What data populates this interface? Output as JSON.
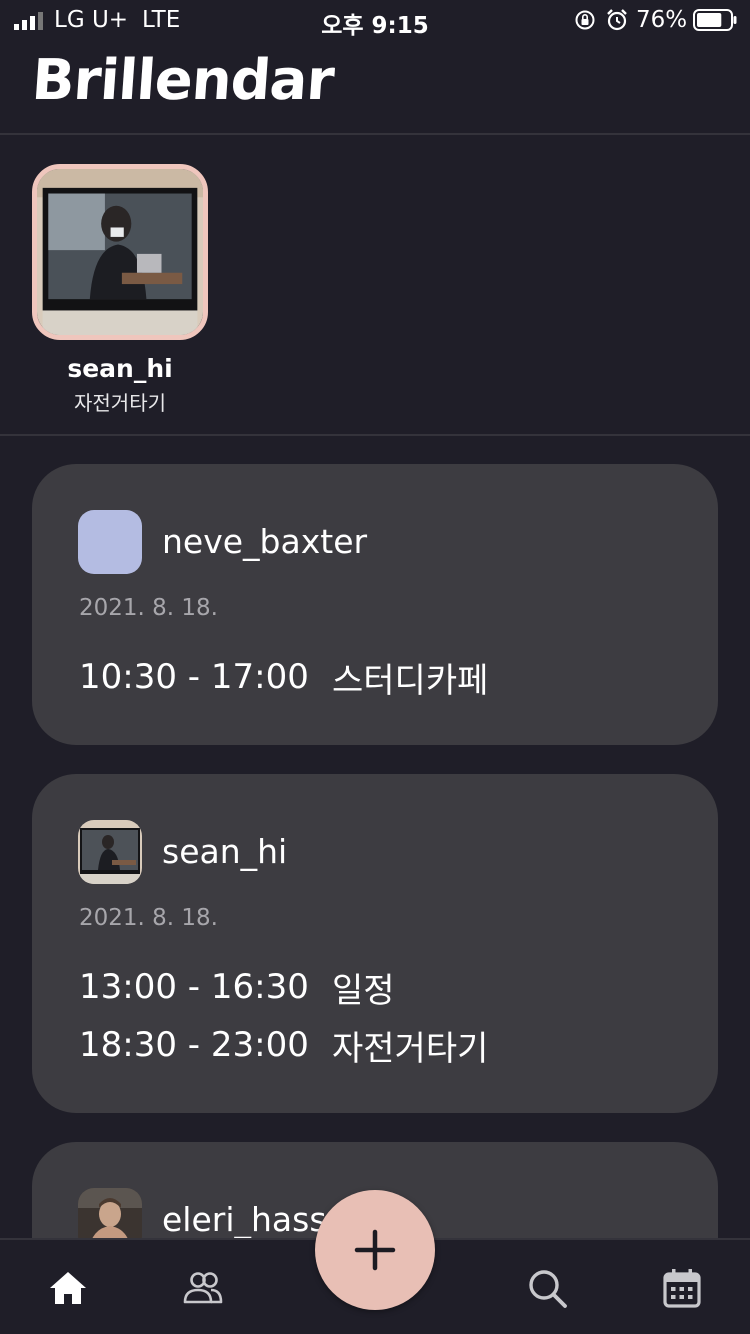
{
  "status_bar": {
    "carrier": "LG U+",
    "network": "LTE",
    "time": "오후 9:15",
    "battery_percent": "76%",
    "battery_level": 0.76
  },
  "header": {
    "title": "Brillendar"
  },
  "stories": [
    {
      "username": "sean_hi",
      "status": "자전거타기"
    }
  ],
  "feed": [
    {
      "username": "neve_baxter",
      "avatar_color": "#b4bce2",
      "date": "2021. 8. 18.",
      "events": [
        {
          "time": "10:30 - 17:00",
          "title": "스터디카페"
        }
      ]
    },
    {
      "username": "sean_hi",
      "date": "2021. 8. 18.",
      "events": [
        {
          "time": "13:00 - 16:30",
          "title": "일정"
        },
        {
          "time": "18:30 - 23:00",
          "title": "자전거타기"
        }
      ]
    },
    {
      "username": "eleri_hass"
    }
  ],
  "tab_bar": {
    "tabs": [
      {
        "icon": "home-icon",
        "active": true
      },
      {
        "icon": "friends-icon",
        "active": false
      },
      {
        "icon": "search-icon",
        "active": false
      },
      {
        "icon": "calendar-icon",
        "active": false
      }
    ],
    "fab_icon": "plus-icon"
  },
  "colors": {
    "background": "#1f1e28",
    "card": "#3d3c41",
    "accent": "#e8bfb5",
    "story_border": "#efc6bd",
    "muted_text": "#a7a6ab"
  }
}
